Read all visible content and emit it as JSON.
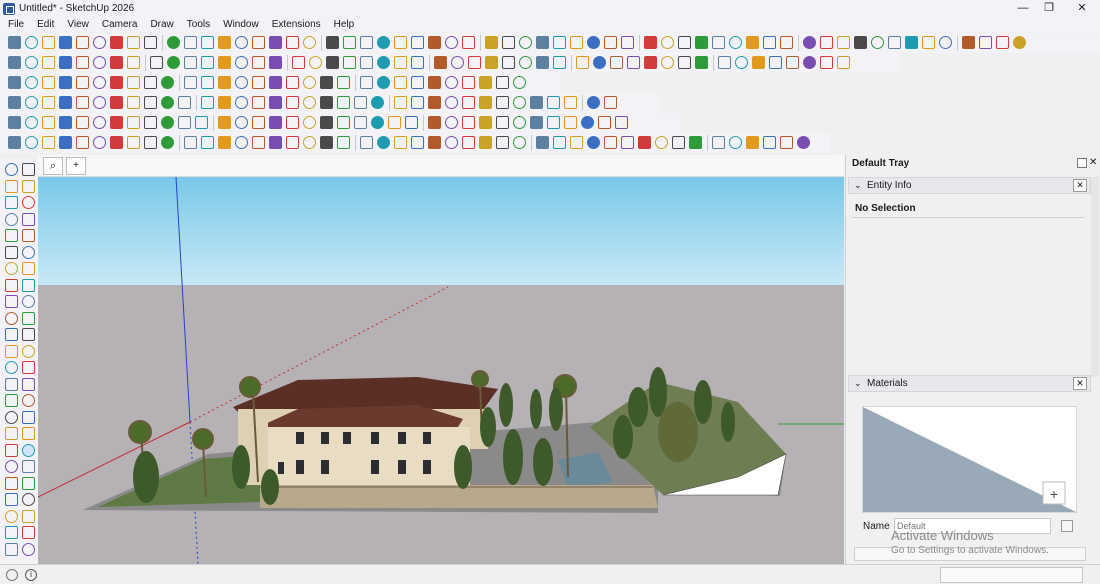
{
  "window": {
    "title": "Untitled* - SketchUp 2026",
    "minimize_glyph": "—",
    "maximize_glyph": "❐",
    "close_glyph": "✕"
  },
  "menu": [
    "File",
    "Edit",
    "View",
    "Camera",
    "Draw",
    "Tools",
    "Window",
    "Extensions",
    "Help"
  ],
  "view_tabs": {
    "search_glyph": "⌕",
    "add_glyph": "+"
  },
  "tray": {
    "title": "Default Tray",
    "entity_info": {
      "header": "Entity Info",
      "selection_text": "No Selection"
    },
    "materials": {
      "header": "Materials",
      "name_label": "Name",
      "name_placeholder": "Default"
    }
  },
  "watermark": {
    "line1": "Activate Windows",
    "line2": "Go to Settings to activate Windows."
  },
  "colors": {
    "sky_top": "#79c8e8",
    "sky_bottom": "#c5e8f6",
    "ground": "#b4b0b4",
    "accent_tool": "#d0e6f7"
  }
}
